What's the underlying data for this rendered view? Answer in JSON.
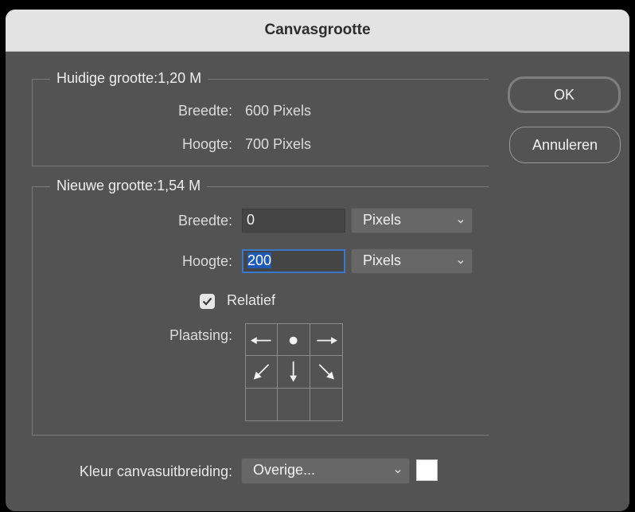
{
  "dialog": {
    "title": "Canvasgrootte"
  },
  "current_size": {
    "label": "Huidige grootte:1,20 M",
    "width_label": "Breedte:",
    "width_value": "600 Pixels",
    "height_label": "Hoogte:",
    "height_value": "700 Pixels"
  },
  "new_size": {
    "label": "Nieuwe grootte:1,54 M",
    "width_label": "Breedte:",
    "width_value": "0",
    "width_unit": "Pixels",
    "height_label": "Hoogte:",
    "height_value": "200",
    "height_unit": "Pixels",
    "relative_label": "Relatief",
    "relative_checked": true,
    "anchor_label": "Plaatsing:"
  },
  "extension_color": {
    "label": "Kleur canvasuitbreiding:",
    "value": "Overige...",
    "swatch_color": "#ffffff"
  },
  "buttons": {
    "ok": "OK",
    "cancel": "Annuleren"
  }
}
